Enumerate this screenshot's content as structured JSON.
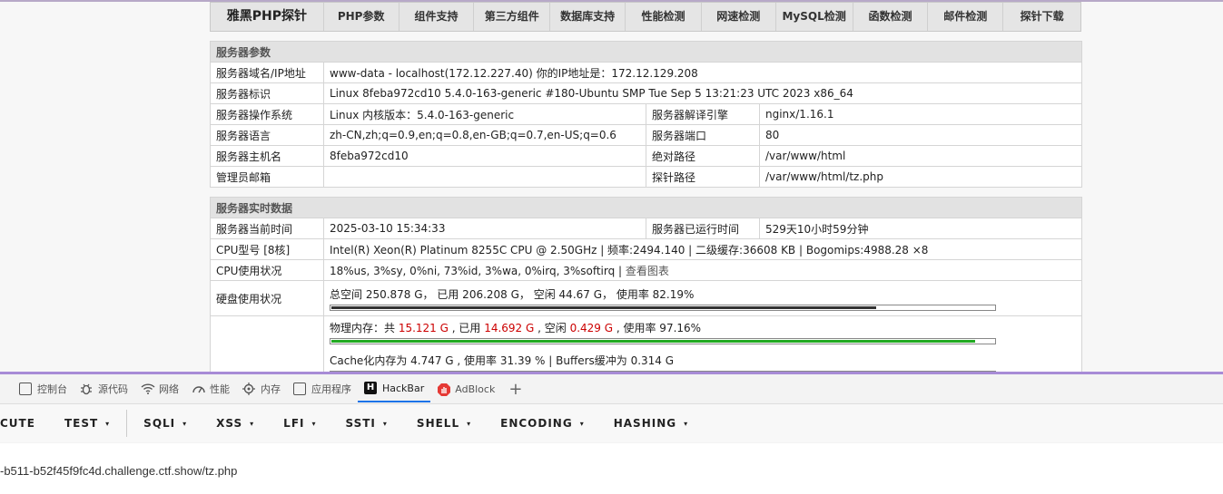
{
  "nav": {
    "items": [
      "雅黑PHP探针",
      "PHP参数",
      "组件支持",
      "第三方组件",
      "数据库支持",
      "性能检测",
      "网速检测",
      "MySQL检测",
      "函数检测",
      "邮件检测",
      "探针下载"
    ]
  },
  "server_params": {
    "title": "服务器参数",
    "rows": {
      "domain_label": "服务器域名/IP地址",
      "domain_value": "www-data - localhost(172.12.227.40)  你的IP地址是：172.12.129.208",
      "ident_label": "服务器标识",
      "ident_value": "Linux 8feba972cd10 5.4.0-163-generic #180-Ubuntu SMP Tue Sep 5 13:21:23 UTC 2023 x86_64",
      "os_label": "服务器操作系统",
      "os_value": "Linux  内核版本：5.4.0-163-generic",
      "engine_label": "服务器解译引擎",
      "engine_value": "nginx/1.16.1",
      "lang_label": "服务器语言",
      "lang_value": "zh-CN,zh;q=0.9,en;q=0.8,en-GB;q=0.7,en-US;q=0.6",
      "port_label": "服务器端口",
      "port_value": "80",
      "host_label": "服务器主机名",
      "host_value": "8feba972cd10",
      "abspath_label": "绝对路径",
      "abspath_value": "/var/www/html",
      "admin_label": "管理员邮箱",
      "admin_value": "",
      "probe_label": "探针路径",
      "probe_value": "/var/www/html/tz.php"
    }
  },
  "realtime": {
    "title": "服务器实时数据",
    "time_label": "服务器当前时间",
    "time_value": "2025-03-10 15:34:33",
    "uptime_label": "服务器已运行时间",
    "uptime_value": "529天10小时59分钟",
    "cpu_label": "CPU型号 [8核]",
    "cpu_value": "Intel(R) Xeon(R) Platinum 8255C CPU @ 2.50GHz | 频率:2494.140 | 二级缓存:36608 KB | Bogomips:4988.28 ×8",
    "cpu_usage_label": "CPU使用状况",
    "cpu_usage_value": "18%us, 3%sy, 0%ni, 73%id, 3%wa, 0%irq, 3%softirq | ",
    "cpu_chart_link": "查看图表",
    "disk_label": "硬盘使用状况",
    "disk_text": "总空间 250.878 G，  已用 206.208 G，  空闲 44.67 G，  使用率 82.19%",
    "disk_usage": 0.8219,
    "mem": {
      "prefix": "物理内存：共 ",
      "total": "15.121 G",
      "used_prefix": " , 已用 ",
      "used": "14.692 G",
      "free_prefix": " , 空闲 ",
      "free": "0.429 G",
      "rate": " , 使用率 97.16%",
      "usage": 0.9716
    },
    "cache_text": "Cache化内存为 4.747 G , 使用率 31.39 % | Buffers缓冲为 0.314 G",
    "cache_usage": 0.3139
  },
  "devtools": {
    "tabs": [
      "控制台",
      "源代码",
      "网络",
      "性能",
      "内存",
      "应用程序",
      "HackBar",
      "AdBlock"
    ],
    "plus": "+"
  },
  "hackbar": {
    "menu": [
      "CUTE",
      "TEST",
      "SQLI",
      "XSS",
      "LFI",
      "SSTI",
      "SHELL",
      "ENCODING",
      "HASHING"
    ],
    "caret": "▾",
    "url": "-b511-b52f45f9fc4d.challenge.ctf.show/tz.php"
  }
}
